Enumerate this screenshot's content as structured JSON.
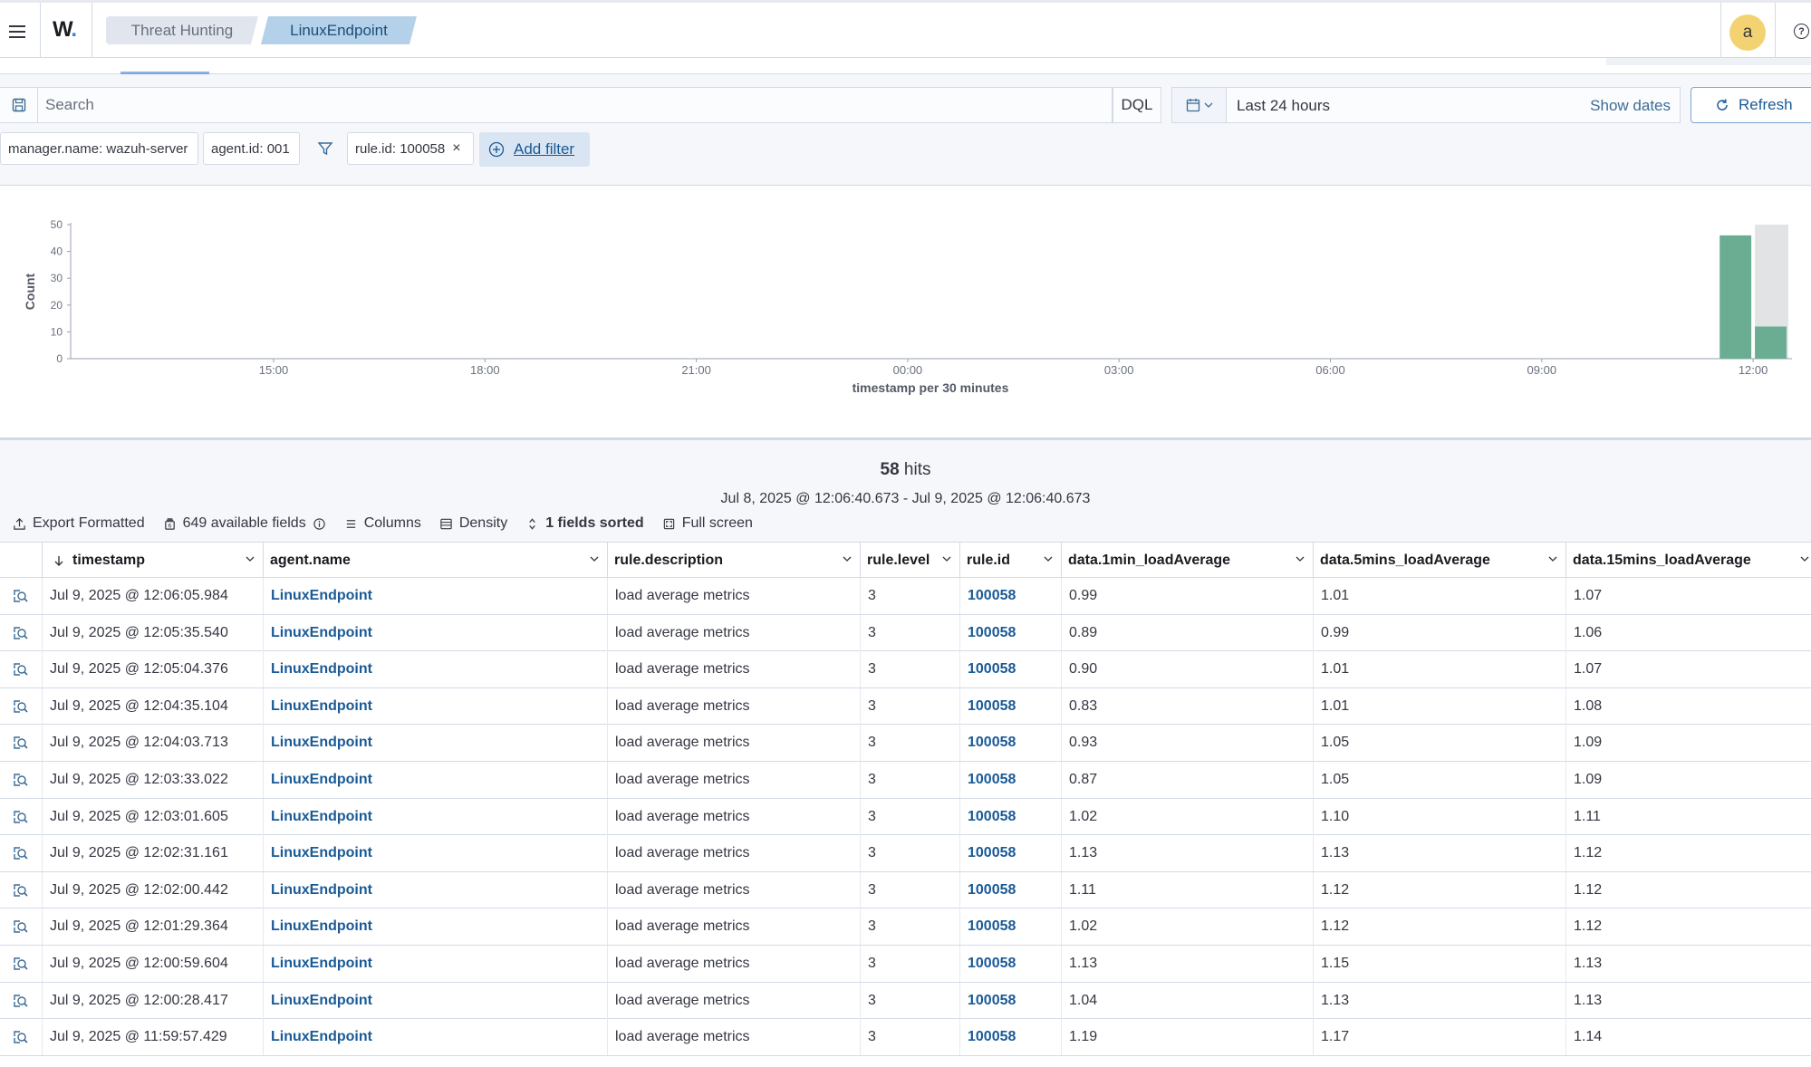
{
  "header": {
    "logo": "W",
    "breadcrumbs": [
      "Threat Hunting",
      "LinuxEndpoint"
    ],
    "avatar_initial": "a",
    "help_glyph": "?"
  },
  "query": {
    "search_placeholder": "Search",
    "language": "DQL",
    "date_range": "Last 24 hours",
    "show_dates": "Show dates",
    "refresh": "Refresh"
  },
  "filters": {
    "pills": [
      "manager.name: wazuh-server",
      "agent.id: 001",
      "rule.id: 100058"
    ],
    "add_filter": "Add filter"
  },
  "chart_data": {
    "type": "bar",
    "xlabel": "timestamp per 30 minutes",
    "ylabel": "Count",
    "x_ticks": [
      "15:00",
      "18:00",
      "21:00",
      "00:00",
      "03:00",
      "06:00",
      "09:00",
      "12:00"
    ],
    "y_ticks": [
      0,
      10,
      20,
      30,
      40,
      50
    ],
    "ylim": [
      0,
      50
    ],
    "series": [
      {
        "bucket": "11:30",
        "value": 46
      },
      {
        "bucket": "12:00",
        "value": 12
      }
    ],
    "highlight_bucket": "12:00",
    "colors": {
      "bar": "#6aad92",
      "highlight_bg": "#e2e3e5",
      "axis": "#98a2b3"
    }
  },
  "hits": {
    "count": "58",
    "label": "hits",
    "range": "Jul 8, 2025 @ 12:06:40.673 - Jul 9, 2025 @ 12:06:40.673"
  },
  "toolbar": {
    "export": "Export Formatted",
    "fields": "649 available fields",
    "columns": "Columns",
    "density": "Density",
    "sorted": "1 fields sorted",
    "fullscreen": "Full screen"
  },
  "table": {
    "columns": [
      "timestamp",
      "agent.name",
      "rule.description",
      "rule.level",
      "rule.id",
      "data.1min_loadAverage",
      "data.5mins_loadAverage",
      "data.15mins_loadAverage"
    ],
    "rows": [
      [
        "Jul 9, 2025 @ 12:06:05.984",
        "LinuxEndpoint",
        "load average metrics",
        "3",
        "100058",
        "0.99",
        "1.01",
        "1.07"
      ],
      [
        "Jul 9, 2025 @ 12:05:35.540",
        "LinuxEndpoint",
        "load average metrics",
        "3",
        "100058",
        "0.89",
        "0.99",
        "1.06"
      ],
      [
        "Jul 9, 2025 @ 12:05:04.376",
        "LinuxEndpoint",
        "load average metrics",
        "3",
        "100058",
        "0.90",
        "1.01",
        "1.07"
      ],
      [
        "Jul 9, 2025 @ 12:04:35.104",
        "LinuxEndpoint",
        "load average metrics",
        "3",
        "100058",
        "0.83",
        "1.01",
        "1.08"
      ],
      [
        "Jul 9, 2025 @ 12:04:03.713",
        "LinuxEndpoint",
        "load average metrics",
        "3",
        "100058",
        "0.93",
        "1.05",
        "1.09"
      ],
      [
        "Jul 9, 2025 @ 12:03:33.022",
        "LinuxEndpoint",
        "load average metrics",
        "3",
        "100058",
        "0.87",
        "1.05",
        "1.09"
      ],
      [
        "Jul 9, 2025 @ 12:03:01.605",
        "LinuxEndpoint",
        "load average metrics",
        "3",
        "100058",
        "1.02",
        "1.10",
        "1.11"
      ],
      [
        "Jul 9, 2025 @ 12:02:31.161",
        "LinuxEndpoint",
        "load average metrics",
        "3",
        "100058",
        "1.13",
        "1.13",
        "1.12"
      ],
      [
        "Jul 9, 2025 @ 12:02:00.442",
        "LinuxEndpoint",
        "load average metrics",
        "3",
        "100058",
        "1.11",
        "1.12",
        "1.12"
      ],
      [
        "Jul 9, 2025 @ 12:01:29.364",
        "LinuxEndpoint",
        "load average metrics",
        "3",
        "100058",
        "1.02",
        "1.12",
        "1.12"
      ],
      [
        "Jul 9, 2025 @ 12:00:59.604",
        "LinuxEndpoint",
        "load average metrics",
        "3",
        "100058",
        "1.13",
        "1.15",
        "1.13"
      ],
      [
        "Jul 9, 2025 @ 12:00:28.417",
        "LinuxEndpoint",
        "load average metrics",
        "3",
        "100058",
        "1.04",
        "1.13",
        "1.13"
      ],
      [
        "Jul 9, 2025 @ 11:59:57.429",
        "LinuxEndpoint",
        "load average metrics",
        "3",
        "100058",
        "1.19",
        "1.17",
        "1.14"
      ]
    ]
  }
}
